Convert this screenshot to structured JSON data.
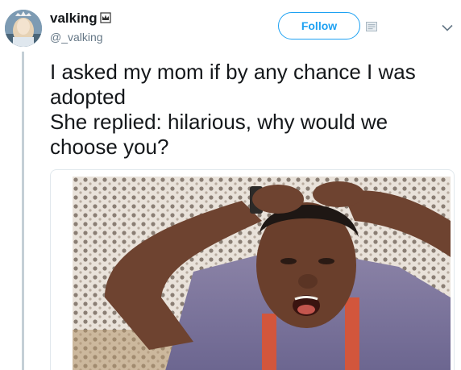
{
  "tweet": {
    "display_name": "valking",
    "handle": "@_valking",
    "follow_label": "Follow",
    "text_lines": [
      "I asked my mom if by any chance I was",
      "adopted",
      "She replied: hilarious, why would we",
      "choose you?"
    ],
    "badge_icon": "crown-icon",
    "card_icon": "card-icon",
    "menu_icon": "chevron-down-icon"
  },
  "colors": {
    "accent": "#1da1f2",
    "text": "#14171a",
    "secondary_text": "#657786",
    "thread_line": "#c4cfd6"
  }
}
